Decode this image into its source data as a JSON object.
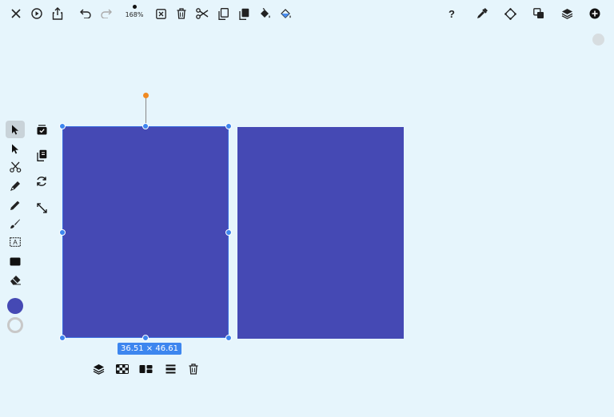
{
  "toolbar": {
    "zoom": "168%",
    "left_icons": [
      "close-icon",
      "play-icon",
      "share-icon",
      "undo-icon",
      "redo-icon"
    ],
    "edit_icons": [
      "delete-x-icon",
      "trash-icon",
      "scissors-icon",
      "copy-icon",
      "paste-icon",
      "paint-bucket-icon",
      "fill-icon"
    ],
    "right_icons": [
      "help-icon",
      "eyedropper-icon",
      "diamond-icon",
      "arrange-icon",
      "layers-icon",
      "add-circle-icon"
    ]
  },
  "canvas": {
    "fill_color": "#4549b4",
    "selection_color": "#3d86ef",
    "rotation_handle_color": "#f08a22",
    "dimension_label": "36.51 × 46.61"
  },
  "tools": [
    "select-arrow",
    "direct-select",
    "scissors",
    "pen",
    "pencil",
    "brush",
    "text",
    "rectangle",
    "eraser"
  ],
  "colors": {
    "fill": "#4549b4",
    "stroke": "#c8c8c8"
  },
  "context_menu": [
    "layers-icon",
    "pattern-icon",
    "align-icon",
    "distribute-icon",
    "trash-icon"
  ]
}
